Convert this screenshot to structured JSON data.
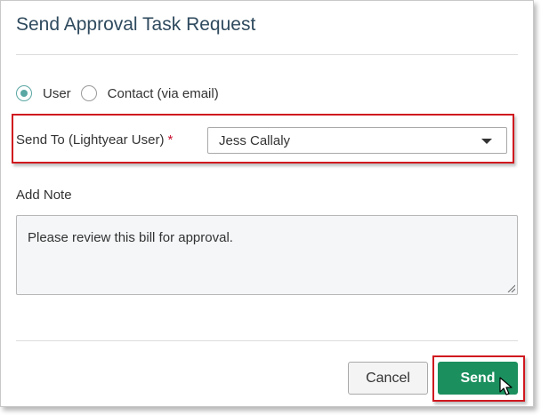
{
  "dialog": {
    "title": "Send Approval Task Request"
  },
  "recipient_type": {
    "options": [
      {
        "label": "User",
        "selected": true
      },
      {
        "label": "Contact (via email)",
        "selected": false
      }
    ]
  },
  "send_to": {
    "label": "Send To (Lightyear User)",
    "required_mark": "*",
    "selected_value": "Jess Callaly"
  },
  "note": {
    "label": "Add Note",
    "value": "Please review this bill for approval."
  },
  "actions": {
    "cancel_label": "Cancel",
    "send_label": "Send"
  },
  "colors": {
    "accent_teal": "#5aa7a3",
    "send_green": "#1b8f5e",
    "highlight_red": "#d0181f",
    "title_color": "#2f4a5e"
  },
  "icons": {
    "dropdown": "chevron-down-icon",
    "resize": "resize-grip-icon",
    "cursor": "mouse-pointer-icon"
  }
}
